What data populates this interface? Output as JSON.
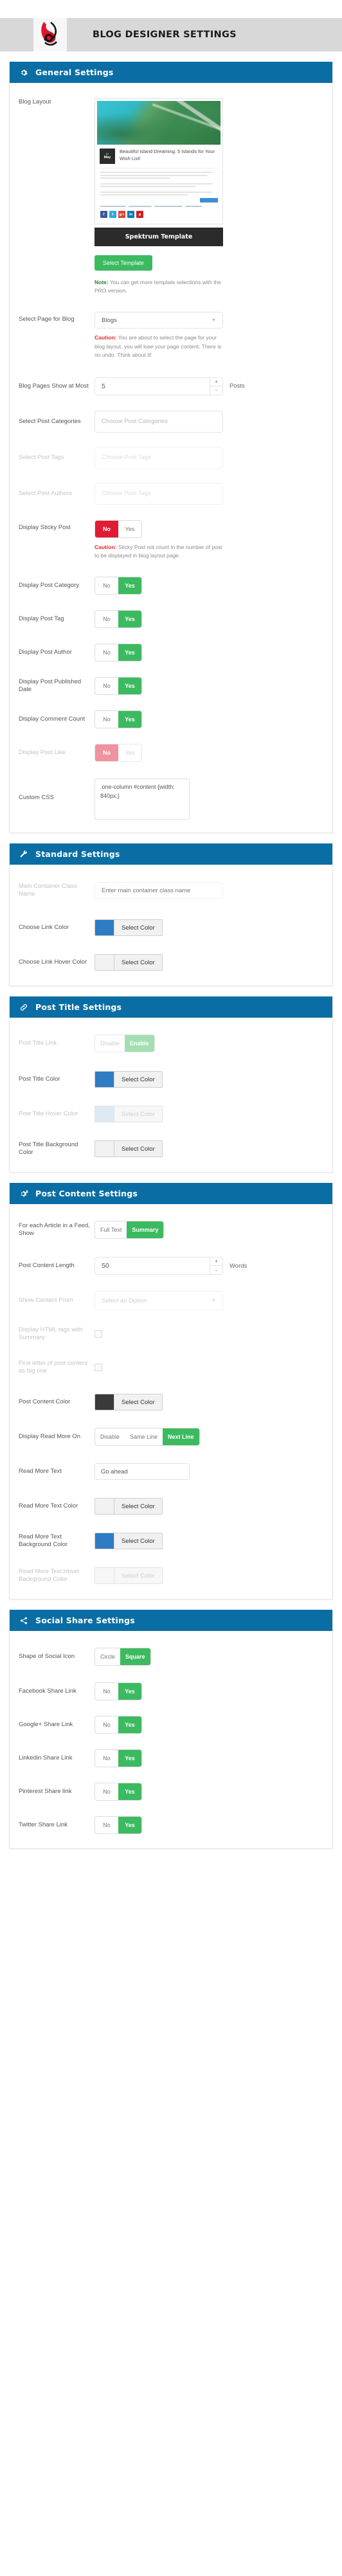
{
  "header": {
    "title": "BLOG DESIGNER SETTINGS",
    "logo_name": "blog-designer-logo"
  },
  "colors": {
    "panel_header_bg": "#0a6ea4",
    "green": "#3cba60",
    "red": "#e01b33",
    "link_color": "#2e7cc4",
    "post_title_color": "#2e7cc4",
    "post_content_color": "#3a3a3a",
    "read_more_bg": "#2e7cc4",
    "read_more_hover_bg": "#f2f2f2",
    "post_title_bg": "#f2f2f2",
    "link_hover_color": "#f2f2f2"
  },
  "panels": [
    {
      "id": "general",
      "title": "General Settings",
      "icon": "gear-icon"
    },
    {
      "id": "standard",
      "title": "Standard Settings",
      "icon": "wrench-icon"
    },
    {
      "id": "post-title",
      "title": "Post Title Settings",
      "icon": "link-icon"
    },
    {
      "id": "post-content",
      "title": "Post Content Settings",
      "icon": "gears-icon"
    },
    {
      "id": "social-share",
      "title": "Social Share Settings",
      "icon": "share-icon"
    }
  ],
  "general": {
    "blog_layout": {
      "label": "Blog Layout",
      "preview": {
        "date_day": "07",
        "date_month": "May",
        "post_title": "Beautiful Island Dreaming: 5 Islands for Your Wish List!",
        "social_icons": [
          "f",
          "t",
          "g+",
          "in",
          "p"
        ]
      },
      "template_name": "Spektrum Template",
      "select_template_button": "Select Template",
      "note_prefix": "Note:",
      "note_text": " You can get more template selections with the PRO version."
    },
    "select_page_for_blog": {
      "label": "Select Page for Blog",
      "value": "Blogs",
      "caution_prefix": "Caution:",
      "caution_text": " You are about to select the page for your blog layout, you will lose your page content. There is no undo. Think about it!"
    },
    "blog_pages_show_at_most": {
      "label": "Blog Pages Show at Most",
      "value": "5",
      "unit": "Posts"
    },
    "select_post_categories": {
      "label": "Select Post Categories",
      "placeholder": "Choose Post Categories"
    },
    "select_post_tags": {
      "label": "Select Post Tags",
      "placeholder": "Choose Post Tags"
    },
    "select_post_authors": {
      "label": "Select Post Authors",
      "placeholder": "Choose Post Tags"
    },
    "display_sticky_post": {
      "label": "Display Sticky Post",
      "options": [
        "No",
        "Yes"
      ],
      "selected": "No",
      "caution_prefix": "Caution:",
      "caution_text": " Sticky Post not count in the number of post to be displayed in blog layout page."
    },
    "display_post_category": {
      "label": "Display Post Category",
      "options": [
        "No",
        "Yes"
      ],
      "selected": "Yes"
    },
    "display_post_tag": {
      "label": "Display Post Tag",
      "options": [
        "No",
        "Yes"
      ],
      "selected": "Yes"
    },
    "display_post_author": {
      "label": "Display Post Author",
      "options": [
        "No",
        "Yes"
      ],
      "selected": "Yes"
    },
    "display_post_published_date": {
      "label": "Display Post Published Date",
      "options": [
        "No",
        "Yes"
      ],
      "selected": "Yes"
    },
    "display_comment_count": {
      "label": "Display Comment Count",
      "options": [
        "No",
        "Yes"
      ],
      "selected": "Yes"
    },
    "display_post_like": {
      "label": "Display Post Like",
      "options": [
        "No",
        "Yes"
      ],
      "selected": "No",
      "disabled": true
    },
    "custom_css": {
      "label": "Custom CSS",
      "value": ".one-column #content {width: 840px;}"
    }
  },
  "standard": {
    "main_container_class_name": {
      "label": "Main Container Class Name",
      "placeholder": "Enter main container class name"
    },
    "choose_link_color": {
      "label": "Choose Link Color",
      "button": "Select Color",
      "swatch": "#2e7cc4"
    },
    "choose_link_hover_color": {
      "label": "Choose Link Hover Color",
      "button": "Select Color",
      "swatch": "#f2f2f2"
    }
  },
  "post_title": {
    "post_title_link": {
      "label": "Post Title Link",
      "options": [
        "Disable",
        "Enable"
      ],
      "selected": "Enable",
      "disabled": true
    },
    "post_title_color": {
      "label": "Post Title Color",
      "button": "Select Color",
      "swatch": "#2e7cc4"
    },
    "post_title_hover_color": {
      "label": "Post Title Hover Color",
      "button": "Select Color",
      "swatch": "#e8eef5",
      "disabled": true
    },
    "post_title_background_color": {
      "label": "Post Title Background Color",
      "button": "Select Color",
      "swatch": "#f2f2f2"
    }
  },
  "post_content": {
    "article_feed_show": {
      "label": "For each Article in a Feed, Show",
      "options": [
        "Full Text",
        "Summary"
      ],
      "selected": "Summary"
    },
    "post_content_length": {
      "label": "Post Content Length",
      "value": "50",
      "unit": "Words"
    },
    "show_content_from": {
      "label": "Show Content From",
      "value": "Select an Option",
      "disabled": true
    },
    "display_html_tags_with_summary": {
      "label": "Display HTML tags with Summary",
      "checked": false,
      "disabled": true
    },
    "first_letter_big": {
      "label": "First letter of post content as big one",
      "checked": false,
      "disabled": true
    },
    "post_content_color": {
      "label": "Post Content Color",
      "button": "Select Color",
      "swatch": "#3a3a3a"
    },
    "display_read_more_on": {
      "label": "Display Read More On",
      "options": [
        "Disable",
        "Same Line",
        "Next Line"
      ],
      "selected": "Next Line"
    },
    "read_more_text": {
      "label": "Read More Text",
      "value": "Go ahead"
    },
    "read_more_text_color": {
      "label": "Read More Text Color",
      "button": "Select Color",
      "swatch": "#f2f2f2"
    },
    "read_more_text_background_color": {
      "label": "Read More Text Background Color",
      "button": "Select Color",
      "swatch": "#2e7cc4"
    },
    "read_more_text_hover_background_color": {
      "label": "Read More Text Hover Background Color",
      "button": "Select Color",
      "swatch": "#f2f2f2",
      "disabled": true
    }
  },
  "social_share": {
    "shape_of_social_icon": {
      "label": "Shape of Social Icon",
      "options": [
        "Circle",
        "Square"
      ],
      "selected": "Square"
    },
    "facebook_share_link": {
      "label": "Facebook Share Link",
      "options": [
        "No",
        "Yes"
      ],
      "selected": "Yes"
    },
    "google_share_link": {
      "label": "Google+ Share Link",
      "options": [
        "No",
        "Yes"
      ],
      "selected": "Yes"
    },
    "linkedin_share_link": {
      "label": "Linkedin Share Link",
      "options": [
        "No",
        "Yes"
      ],
      "selected": "Yes"
    },
    "pinterest_share_link": {
      "label": "Pinterest Share link",
      "options": [
        "No",
        "Yes"
      ],
      "selected": "Yes"
    },
    "twitter_share_link": {
      "label": "Twitter Share Link",
      "options": [
        "No",
        "Yes"
      ],
      "selected": "Yes"
    }
  }
}
